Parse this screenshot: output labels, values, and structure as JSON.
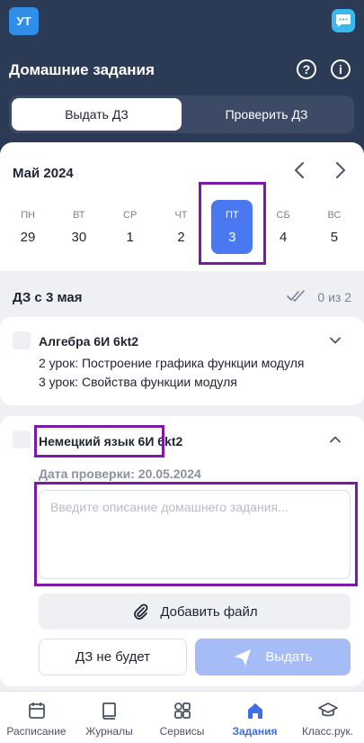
{
  "header": {
    "avatar_initials": "УТ",
    "title": "Домашние задания",
    "help_icon": "help-icon",
    "info_icon": "info-icon",
    "segments": [
      {
        "label": "Выдать ДЗ",
        "active": true
      },
      {
        "label": "Проверить ДЗ",
        "active": false
      }
    ]
  },
  "calendar": {
    "month": "Май 2024",
    "days": [
      {
        "dow": "ПН",
        "num": "29"
      },
      {
        "dow": "ВТ",
        "num": "30"
      },
      {
        "dow": "СР",
        "num": "1"
      },
      {
        "dow": "ЧТ",
        "num": "2"
      },
      {
        "dow": "ПТ",
        "num": "3"
      },
      {
        "dow": "СБ",
        "num": "4"
      },
      {
        "dow": "ВС",
        "num": "5"
      }
    ],
    "selected_day": "3"
  },
  "homework": {
    "title": "ДЗ с 3 мая",
    "count": "0 из 2",
    "cards": [
      {
        "subject": "Алгебра 6И 6kt2",
        "lessons": [
          "2 урок: Построение графика функции модуля",
          "3 урок: Свойства функции модуля"
        ],
        "expanded": false
      },
      {
        "subject": "Немецкий язык 6И 6kt2",
        "due_label": "Дата проверки: 20.05.2024",
        "description_placeholder": "Введите описание домашнего задания...",
        "add_file_label": "Добавить файл",
        "no_homework_label": "ДЗ не будет",
        "send_label": "Выдать",
        "expanded": true
      }
    ]
  },
  "tabbar": [
    {
      "label": "Расписание",
      "icon": "calendar-icon",
      "active": false
    },
    {
      "label": "Журналы",
      "icon": "book-icon",
      "active": false
    },
    {
      "label": "Сервисы",
      "icon": "grid-icon",
      "active": false
    },
    {
      "label": "Задания",
      "icon": "home-icon",
      "active": true
    },
    {
      "label": "Класс.рук.",
      "icon": "graduation-cap-icon",
      "active": false
    }
  ],
  "colors": {
    "header_bg": "#2b3a55",
    "accent": "#4a78f0",
    "highlight": "#7d18a8",
    "active_tab": "#3f6ee8"
  }
}
